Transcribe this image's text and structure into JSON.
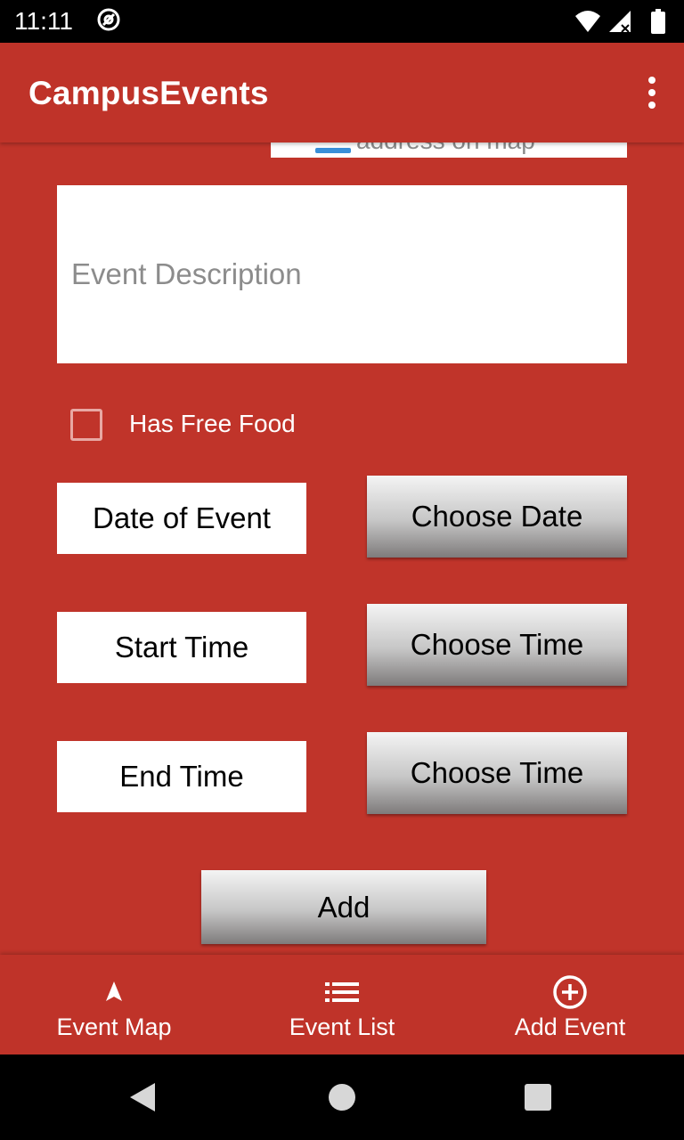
{
  "status_bar": {
    "time": "11:11",
    "icons": [
      "at-sign-icon",
      "wifi-icon",
      "signal-icon",
      "battery-icon"
    ]
  },
  "app_bar": {
    "title": "CampusEvents",
    "menu_icon": "overflow-menu-icon"
  },
  "form": {
    "map_address_partial": "address on map",
    "description_placeholder": "Event Description",
    "description_value": "",
    "free_food_label": "Has Free Food",
    "free_food_checked": false,
    "date_label": "Date of Event",
    "choose_date_label": "Choose Date",
    "start_time_label": "Start Time",
    "choose_start_time_label": "Choose Time",
    "end_time_label": "End Time",
    "choose_end_time_label": "Choose Time",
    "add_label": "Add"
  },
  "bottom_nav": {
    "items": [
      {
        "label": "Event Map",
        "icon": "navigation-arrow-icon"
      },
      {
        "label": "Event List",
        "icon": "list-icon"
      },
      {
        "label": "Add Event",
        "icon": "add-circle-icon"
      }
    ]
  },
  "system_nav": [
    "back-icon",
    "home-icon",
    "recents-icon"
  ],
  "colors": {
    "primary": "#bf3329",
    "background": "#c0342a",
    "on_primary": "#ffffff"
  }
}
